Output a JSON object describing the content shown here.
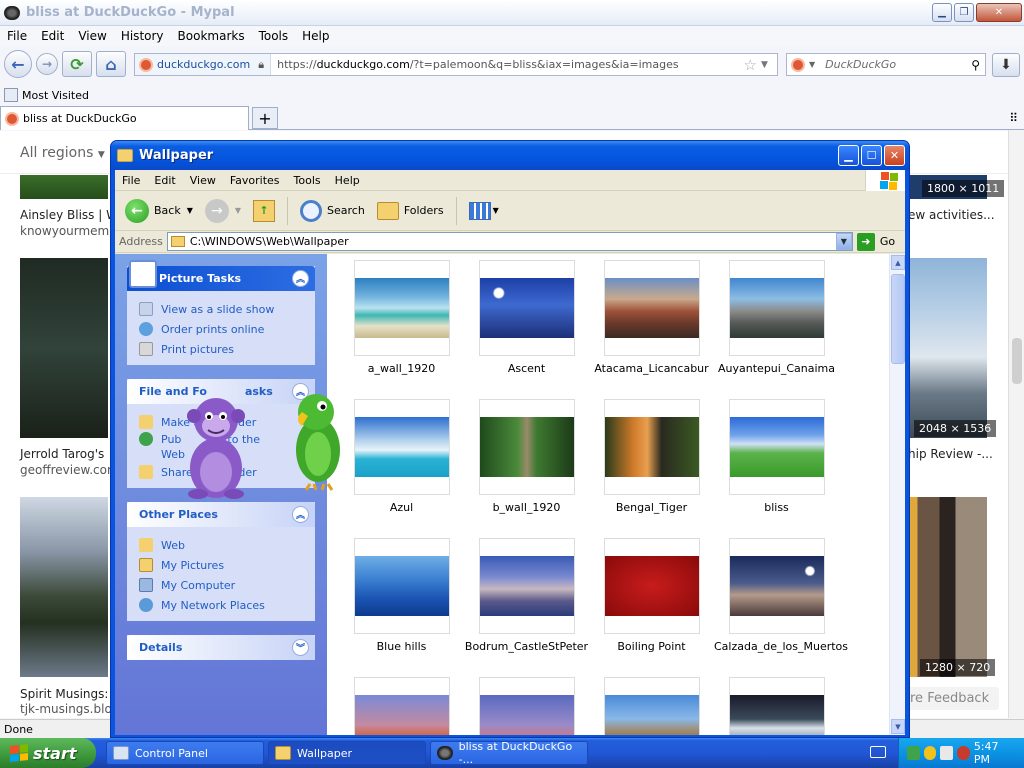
{
  "browser": {
    "title": "bliss at DuckDuckGo - Mypal",
    "menu": [
      "File",
      "Edit",
      "View",
      "History",
      "Bookmarks",
      "Tools",
      "Help"
    ],
    "url_site": "duckduckgo.com",
    "url_prefix": "https://",
    "url_host": "duckduckgo.com",
    "url_rest": "/?t=palemoon&q=bliss&iax=images&ia=images",
    "search_placeholder": "DuckDuckGo",
    "bookmark": "Most Visited",
    "tab_title": "bliss at DuckDuckGo",
    "status": "Done"
  },
  "page": {
    "regions": "All regions",
    "results": [
      {
        "title": "Ainsley Bliss | W",
        "source": "knowyourmeme"
      },
      {
        "title": "Jerrold Tarog's",
        "source": "geoffreview.com"
      },
      {
        "title": "Spirit Musings: I",
        "source": "tjk-musings.blog"
      },
      {
        "title": "ew activities...",
        "source": ""
      },
      {
        "title": "hip Review -...",
        "source": ""
      }
    ],
    "dims": [
      "1800 × 1011",
      "2048 × 1536",
      "1280 × 720"
    ],
    "feedback": "re Feedback"
  },
  "explorer": {
    "title": "Wallpaper",
    "menu": [
      "File",
      "Edit",
      "View",
      "Favorites",
      "Tools",
      "Help"
    ],
    "toolbar": {
      "back": "Back",
      "search": "Search",
      "folders": "Folders"
    },
    "address_label": "Address",
    "address": "C:\\WINDOWS\\Web\\Wallpaper",
    "go": "Go",
    "picture_tasks": {
      "title": "Picture Tasks",
      "items": [
        "View as a slide show",
        "Order prints online",
        "Print pictures"
      ]
    },
    "file_tasks": {
      "title": "File and Fo",
      "title_tail": "asks",
      "items": [
        "Make a",
        "Pub",
        "Web",
        "Share"
      ],
      "items_tail": [
        "older",
        "to the",
        "",
        "folder"
      ]
    },
    "other_places": {
      "title": "Other Places",
      "items": [
        "Web",
        "My Pictures",
        "My Computer",
        "My Network Places"
      ]
    },
    "details": {
      "title": "Details"
    },
    "files": [
      "a_wall_1920",
      "Ascent",
      "Atacama_Licancabur",
      "Auyantepui_Canaima",
      "Azul",
      "b_wall_1920",
      "Bengal_Tiger",
      "bliss",
      "Blue hills",
      "Bodrum_CastleStPeter",
      "Boiling Point",
      "Calzada_de_los_Muertos"
    ]
  },
  "taskbar": {
    "start": "start",
    "tasks": [
      "Control Panel",
      "Wallpaper",
      "bliss at DuckDuckGo -..."
    ],
    "clock": "5:47 PM"
  }
}
